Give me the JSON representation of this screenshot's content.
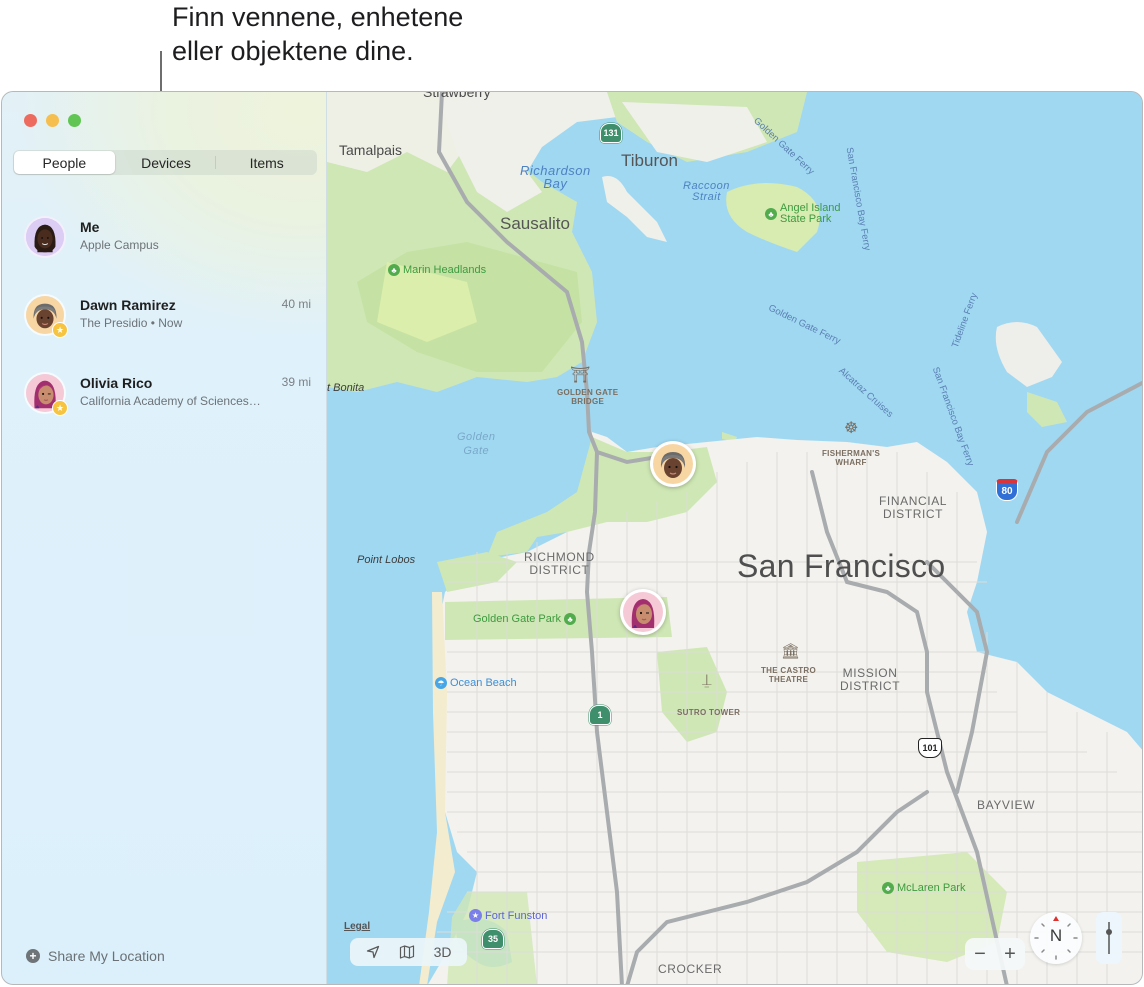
{
  "callout": {
    "line1": "Finn vennene, enhetene",
    "line2": "eller objektene dine."
  },
  "window": {
    "traffic_lights": [
      "close",
      "minimize",
      "zoom"
    ]
  },
  "sidebar": {
    "tabs": [
      {
        "label": "People",
        "active": true
      },
      {
        "label": "Devices",
        "active": false
      },
      {
        "label": "Items",
        "active": false
      }
    ],
    "people": [
      {
        "name": "Me",
        "subtitle": "Apple Campus",
        "distance": "",
        "favorite": false
      },
      {
        "name": "Dawn Ramirez",
        "subtitle": "The Presidio • Now",
        "distance": "40 mi",
        "favorite": true
      },
      {
        "name": "Olivia Rico",
        "subtitle": "California Academy of Sciences…",
        "distance": "39 mi",
        "favorite": true
      }
    ],
    "share_label": "Share My Location",
    "share_icon": "plus-circle-icon"
  },
  "map": {
    "labels": {
      "strawberry": "Strawberry",
      "tamalpais": "Tamalpais",
      "tiburon": "Tiburon",
      "sausalito": "Sausalito",
      "richardson_bay_1": "Richardson",
      "richardson_bay_2": "Bay",
      "raccoon_1": "Raccoon",
      "raccoon_2": "Strait",
      "angel_island_1": "Angel Island",
      "angel_island_2": "State Park",
      "marin_headlands": "Marin Headlands",
      "point_bonita": "t Bonita",
      "golden_gate_1": "Golden",
      "golden_gate_2": "Gate",
      "ggb_1": "GOLDEN GATE",
      "ggb_2": "BRIDGE",
      "fishermans_1": "FISHERMAN'S",
      "fishermans_2": "WHARF",
      "financial_1": "FINANCIAL",
      "financial_2": "DISTRICT",
      "point_lobos": "Point Lobos",
      "richmond_1": "RICHMOND",
      "richmond_2": "DISTRICT",
      "san_francisco": "San Francisco",
      "ggpark": "Golden Gate Park",
      "ocean_beach": "Ocean Beach",
      "castro_1": "THE CASTRO",
      "castro_2": "THEATRE",
      "mission_1": "MISSION",
      "mission_2": "DISTRICT",
      "sutro": "SUTRO TOWER",
      "bayview": "BAYVIEW",
      "mclaren": "McLaren Park",
      "fort_funston": "Fort Funston",
      "crocker": "CROCKER",
      "ferry_gg1": "Golden Gate Ferry",
      "ferry_sfbay1": "San Francisco Bay Ferry",
      "ferry_gg2": "Golden Gate Ferry",
      "ferry_alcatraz": "Alcatraz Cruises",
      "ferry_sfbay2": "San Francisco Bay Ferry",
      "ferry_tideline": "Tideline Ferry",
      "ferry_partial": "Ferry"
    },
    "shields": {
      "ca131": "131",
      "ca1": "1",
      "ca35": "35",
      "us101": "101",
      "i80": "80"
    },
    "legal_label": "Legal",
    "controls": {
      "location_icon": "location-arrow-icon",
      "map_icon": "map-icon",
      "three_d": "3D",
      "zoom_out": "−",
      "zoom_in": "+",
      "compass": "N"
    }
  }
}
